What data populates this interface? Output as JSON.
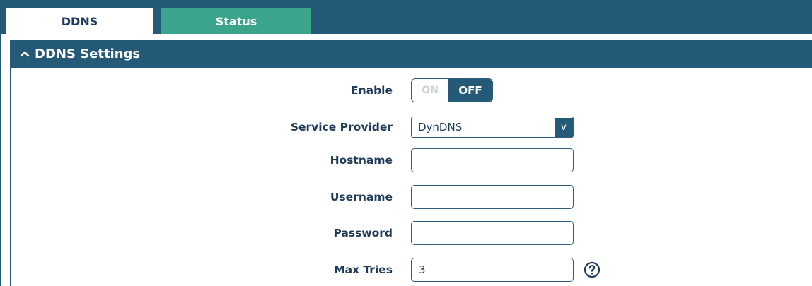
{
  "tabs": [
    {
      "label": "DDNS",
      "active": true
    },
    {
      "label": "Status",
      "active": false
    }
  ],
  "section": {
    "title": "DDNS Settings",
    "icon": "chevron-up-icon"
  },
  "form": {
    "enable": {
      "label": "Enable",
      "on_label": "ON",
      "off_label": "OFF",
      "state": "OFF"
    },
    "service_provider": {
      "label": "Service Provider",
      "value": "DynDNS",
      "arrow": "v"
    },
    "hostname": {
      "label": "Hostname",
      "value": ""
    },
    "username": {
      "label": "Username",
      "value": ""
    },
    "password": {
      "label": "Password",
      "value": ""
    },
    "max_tries": {
      "label": "Max Tries",
      "value": "3",
      "help_icon": "help-icon"
    }
  },
  "colors": {
    "header_bg": "#255978",
    "status_tab_bg": "#3aa58c",
    "text": "#1f3b57"
  }
}
